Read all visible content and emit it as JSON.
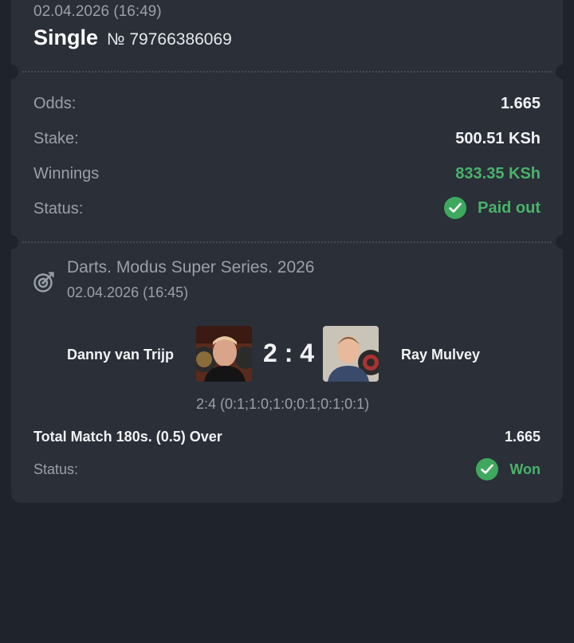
{
  "ticket": {
    "datetime": "02.04.2026 (16:49)",
    "type": "Single",
    "number": "№ 79766386069"
  },
  "summary": {
    "odds_label": "Odds:",
    "odds_value": "1.665",
    "stake_label": "Stake:",
    "stake_value": "500.51 KSh",
    "winnings_label": "Winnings",
    "winnings_value": "833.35 KSh",
    "status_label": "Status:",
    "status_value": "Paid out"
  },
  "event": {
    "icon": "darts-target-icon",
    "title": "Darts. Modus Super Series. 2026",
    "datetime": "02.04.2026 (16:45)",
    "home_player": "Danny van Trijp",
    "away_player": "Ray Mulvey",
    "score": "2 : 4",
    "score_detail": "2:4 (0:1;1:0;1:0;0:1;0:1;0:1)",
    "market": "Total Match 180s. (0.5) Over",
    "market_odds": "1.665",
    "status_label": "Status:",
    "status_value": "Won"
  },
  "colors": {
    "background": "#1f232b",
    "card": "#2a2f38",
    "accent_green": "#49b36b"
  }
}
